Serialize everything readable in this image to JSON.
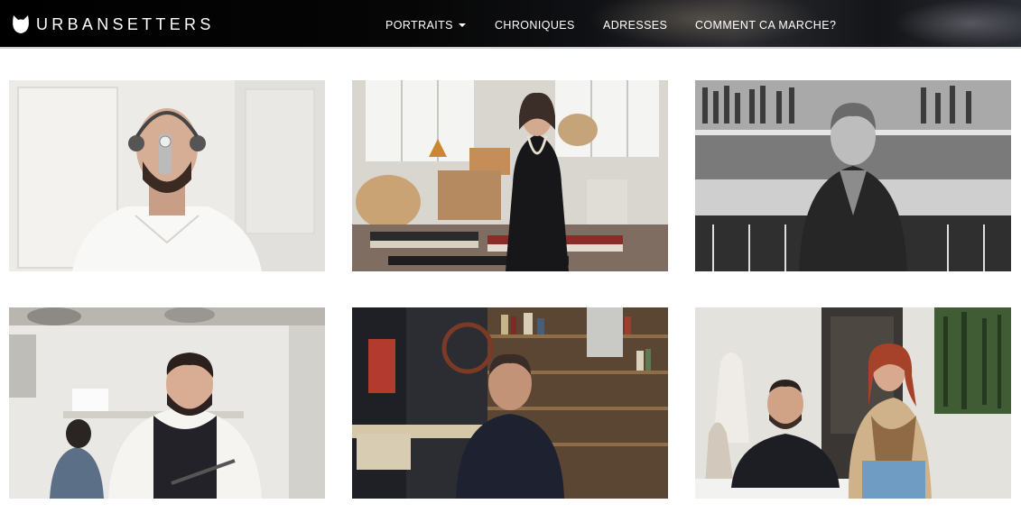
{
  "header": {
    "logo_text": "URBANSETTERS",
    "logo_icon": "cat-head-icon",
    "nav": [
      {
        "label": "PORTRAITS",
        "has_dropdown": true
      },
      {
        "label": "CHRONIQUES",
        "has_dropdown": false
      },
      {
        "label": "ADRESSES",
        "has_dropdown": false
      },
      {
        "label": "COMMENT CA MARCHE?",
        "has_dropdown": false
      }
    ]
  },
  "portraits": [
    {
      "name": "portrait-headphones-man"
    },
    {
      "name": "portrait-woman-textile-studio"
    },
    {
      "name": "portrait-man-bar-bw"
    },
    {
      "name": "portrait-chef-kitchen"
    },
    {
      "name": "portrait-man-bookshelf"
    },
    {
      "name": "portrait-couple-interior"
    }
  ]
}
